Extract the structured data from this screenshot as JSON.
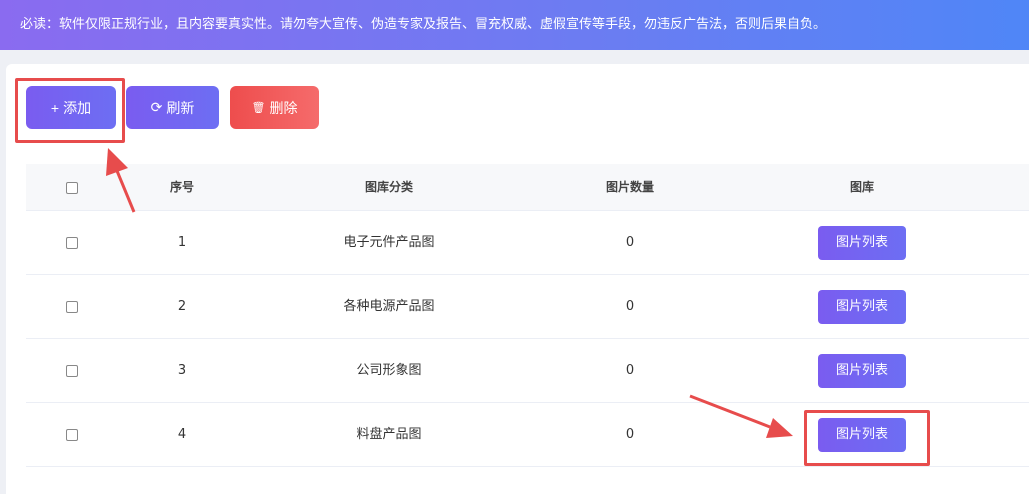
{
  "notice": "必读：软件仅限正规行业，且内容要真实性。请勿夸大宣传、伪造专家及报告、冒充权威、虚假宣传等手段，勿违反广告法，否则后果自负。",
  "toolbar": {
    "add_label": "添加",
    "add_glyph": "+",
    "refresh_label": "刷新",
    "refresh_glyph": "⟳",
    "delete_label": "删除",
    "delete_glyph": "🗑"
  },
  "table": {
    "headers": {
      "index": "序号",
      "category": "图库分类",
      "count": "图片数量",
      "library": "图库"
    },
    "rows": [
      {
        "index": "1",
        "category": "电子元件产品图",
        "count": "0",
        "action": "图片列表"
      },
      {
        "index": "2",
        "category": "各种电源产品图",
        "count": "0",
        "action": "图片列表"
      },
      {
        "index": "3",
        "category": "公司形象图",
        "count": "0",
        "action": "图片列表"
      },
      {
        "index": "4",
        "category": "料盘产品图",
        "count": "0",
        "action": "图片列表"
      }
    ]
  },
  "colors": {
    "accent": "#7a5cf0",
    "danger": "#ee4d4d",
    "annotation": "#e74c4c"
  }
}
